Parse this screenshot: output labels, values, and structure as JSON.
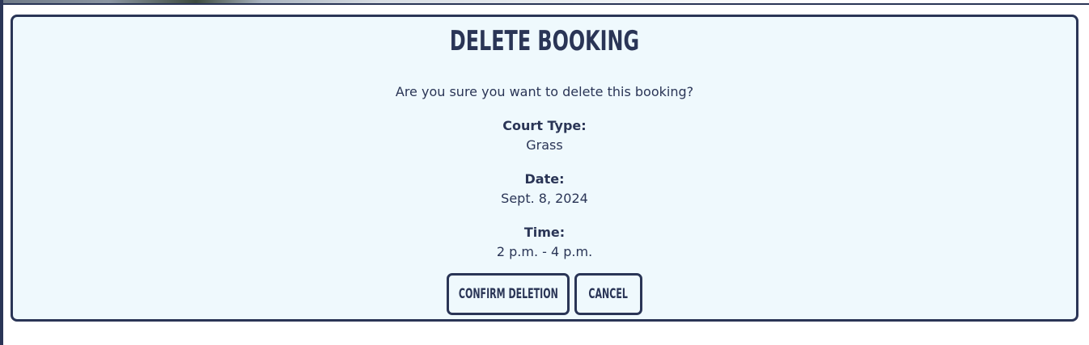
{
  "dialog": {
    "title": "Delete Booking",
    "question": "Are you sure you want to delete this booking?",
    "fields": [
      {
        "label": "Court Type:",
        "value": "Grass"
      },
      {
        "label": "Date:",
        "value": "Sept. 8, 2024"
      },
      {
        "label": "Time:",
        "value": "2 p.m. - 4 p.m."
      }
    ],
    "confirm_label": "Confirm Deletion",
    "cancel_label": "Cancel"
  },
  "colors": {
    "primary": "#2a3556",
    "card_background": "#eff9fd"
  }
}
